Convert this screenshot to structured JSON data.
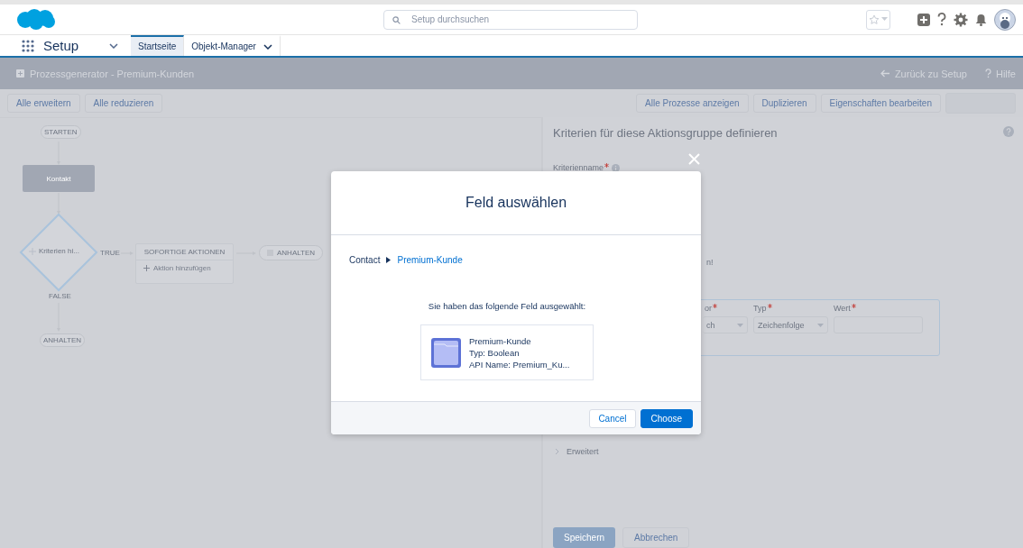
{
  "header": {
    "search": {
      "placeholder": "Setup durchsuchen"
    }
  },
  "nav": {
    "app_name": "Setup",
    "tabs": [
      {
        "label": "Startseite",
        "selected": true,
        "has_menu": false
      },
      {
        "label": "Objekt-Manager",
        "selected": false,
        "has_menu": true
      }
    ]
  },
  "title_bar": {
    "title": "Prozessgenerator - Premium-Kunden",
    "back_link": "Zurück zu Setup",
    "help_link": "Hilfe"
  },
  "toolbar": {
    "left_buttons": [
      "Alle erweitern",
      "Alle reduzieren"
    ],
    "right_buttons": [
      "Alle Prozesse anzeigen",
      "Duplizieren",
      "Eigenschaften bearbeiten"
    ]
  },
  "flow": {
    "start": "STARTEN",
    "object": "Kontakt",
    "criteria": "Kriterien hi...",
    "true_label": "TRUE",
    "false_label": "FALSE",
    "actions_header": "SOFORTIGE AKTIONEN",
    "add_action": "Aktion hinzufügen",
    "end_true": "ANHALTEN",
    "end_false": "ANHALTEN"
  },
  "criteria_panel": {
    "title": "Kriterien für diese Aktionsgruppe definieren",
    "name_label": "Kriterienname",
    "name_required": true,
    "hint_fragment": "n!",
    "condition": {
      "operator_label": "or",
      "operator_required": true,
      "operator_value": "ch",
      "type_label": "Typ",
      "type_required": true,
      "type_value": "Zeichenfolge",
      "value_label": "Wert",
      "value_required": true
    },
    "advanced": "Erweitert",
    "save": "Speichern",
    "cancel": "Abbrechen"
  },
  "modal": {
    "title": "Feld auswählen",
    "breadcrumb": [
      "Contact",
      "Premium-Kunde"
    ],
    "message": "Sie haben das folgende Feld ausgewählt:",
    "field": {
      "name": "Premium-Kunde",
      "type": "Typ: Boolean",
      "api_name": "API Name: Premium_Ku..."
    },
    "buttons": [
      {
        "label": "Cancel",
        "kind": "neutral"
      },
      {
        "label": "Choose",
        "kind": "brand"
      }
    ]
  }
}
